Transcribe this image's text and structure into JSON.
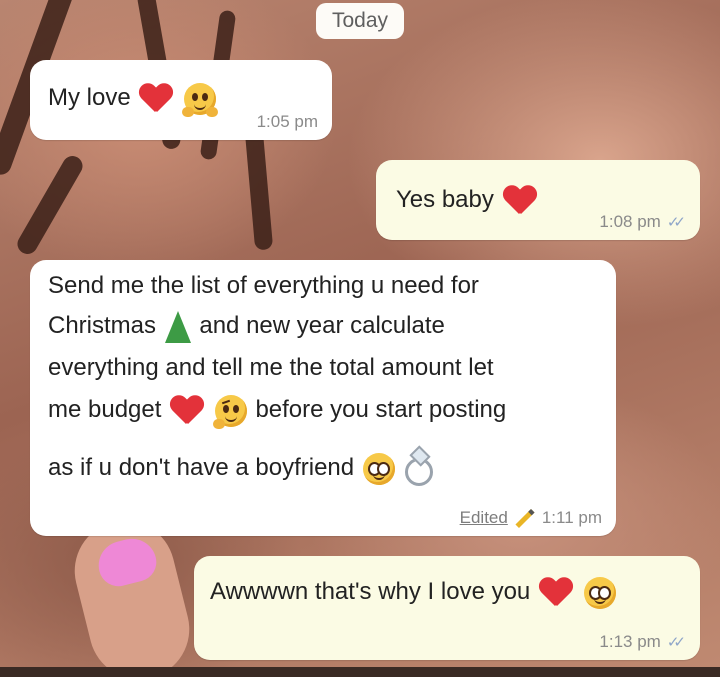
{
  "date_chip": "Today",
  "messages": [
    {
      "direction": "incoming",
      "text": "My love",
      "emoji": [
        "red-heart",
        "hugging-face"
      ],
      "time": "1:05 pm"
    },
    {
      "direction": "outgoing",
      "text": "Yes baby",
      "emoji": [
        "red-heart"
      ],
      "time": "1:08 pm",
      "status": "read-double-tick"
    },
    {
      "direction": "incoming",
      "lines": [
        "Send me the list of everything u need for",
        "Christmas",
        "and new year calculate",
        "everything and tell me the total amount let",
        "me budget",
        "before you start posting",
        "as if u don't have a boyfriend"
      ],
      "emoji": [
        "christmas-tree",
        "red-heart",
        "thinking-face",
        "pleading-face",
        "ring"
      ],
      "edited_label": "Edited",
      "time": "1:11 pm"
    },
    {
      "direction": "outgoing",
      "text": "Awwwwn that's why I love you",
      "emoji": [
        "red-heart",
        "pleading-face"
      ],
      "time": "1:13 pm",
      "status": "read-double-tick"
    }
  ],
  "colors": {
    "incoming_bubble": "#ffffff",
    "outgoing_bubble": "#fbfbe4",
    "heart": "#e3323a",
    "tick": "#8fa6c9"
  }
}
